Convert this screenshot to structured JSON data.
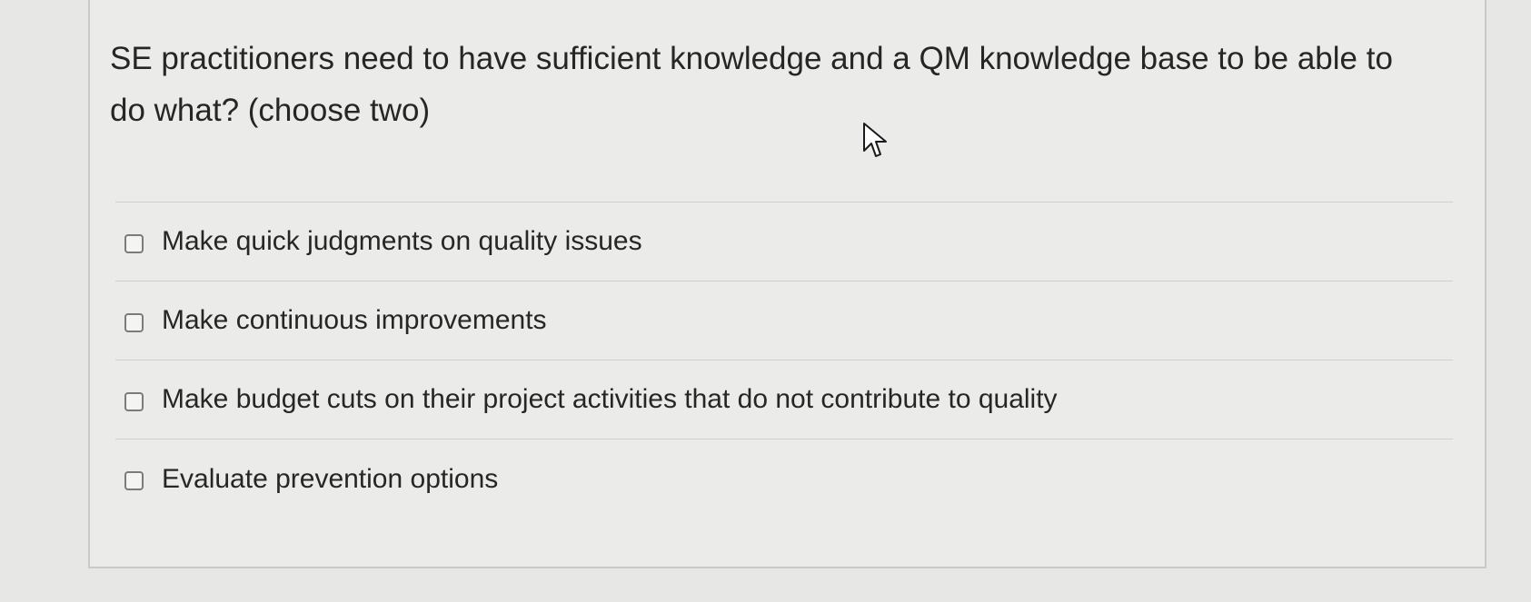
{
  "question": {
    "text": "SE practitioners need to have sufficient knowledge and a QM knowledge base to be able to do what? (choose two)"
  },
  "options": [
    {
      "label": "Make quick judgments on quality issues",
      "checked": false
    },
    {
      "label": "Make continuous improvements",
      "checked": false
    },
    {
      "label": "Make budget cuts on their project activities that do not contribute to quality",
      "checked": false
    },
    {
      "label": "Evaluate prevention options",
      "checked": false
    }
  ],
  "cursor": {
    "icon": "arrow-cursor-icon"
  }
}
